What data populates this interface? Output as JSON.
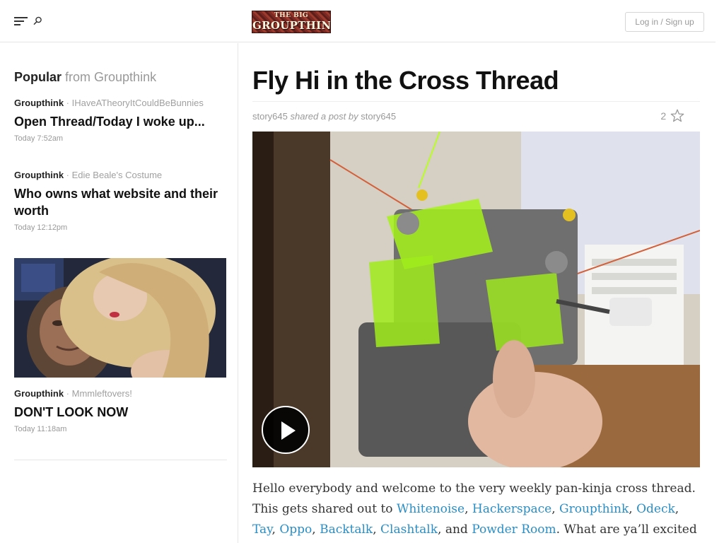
{
  "header": {
    "logo_line1": "THE BIG",
    "logo_line2": "GROUPTHINK",
    "login_label": "Log in / Sign up",
    "icons": [
      "menu-icon",
      "search-icon"
    ]
  },
  "sidebar": {
    "heading_bold": "Popular",
    "heading_rest": "from Groupthink",
    "stories": [
      {
        "blog": "Groupthink",
        "sep": "·",
        "category": "IHaveATheoryItCouldBeBunnies",
        "title": "Open Thread/Today I woke up...",
        "time": "Today 7:52am"
      },
      {
        "blog": "Groupthink",
        "sep": "·",
        "category": "Edie Beale's Costume",
        "title": "Who owns what website and their worth",
        "time": "Today 12:12pm"
      },
      {
        "blog": "Groupthink",
        "sep": "·",
        "category": "Mmmleftovers!",
        "title": "DON'T LOOK NOW",
        "time": "Today 11:18am"
      }
    ]
  },
  "article": {
    "title": "Fly Hi in the Cross Thread",
    "byline_author1": "story645",
    "byline_middle": "shared a post by",
    "byline_author2": "story645",
    "star_count": "2",
    "body_intro": "Hello everybody and welcome to the very weekly pan-kinja cross thread. This gets shared out to ",
    "links": [
      "Whitenoise",
      "Hackerspace",
      "Groupthink",
      "Odeck",
      "Tay",
      "Oppo",
      "Backtalk",
      "Clashtalk",
      "Powder Room"
    ],
    "comma": ", ",
    "and_text": ", and ",
    "body_outro": ". What are ya’ll excited about?"
  },
  "colors": {
    "link": "#2a8ec6",
    "muted": "#999999",
    "rule": "#e5e5e5"
  }
}
